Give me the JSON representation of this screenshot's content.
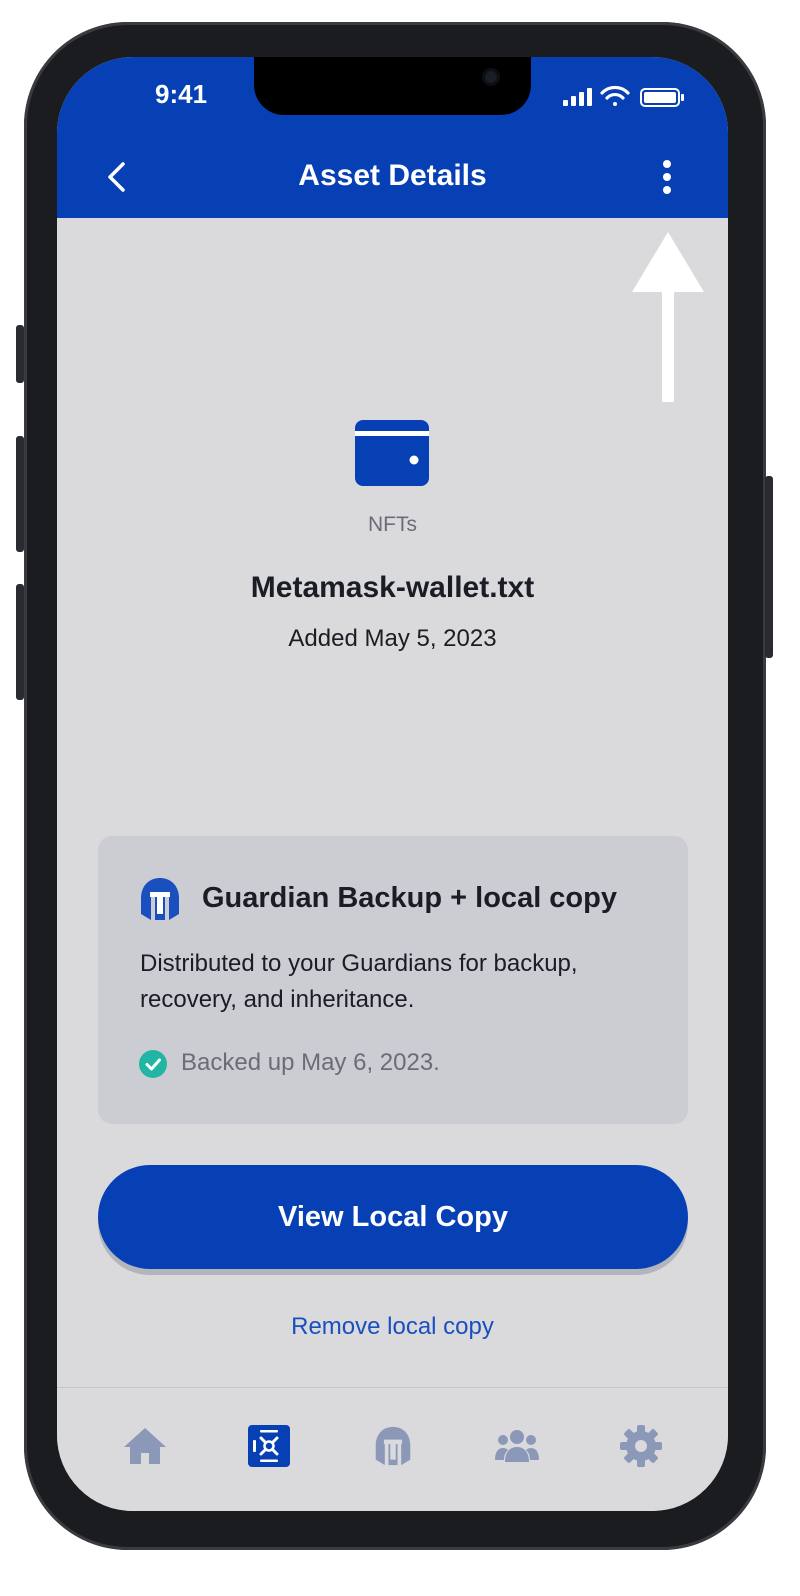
{
  "status_bar": {
    "time": "9:41"
  },
  "header": {
    "title": "Asset Details"
  },
  "asset": {
    "category": "NFTs",
    "name": "Metamask-wallet.txt",
    "added": "Added May 5, 2023"
  },
  "backup_card": {
    "title": "Guardian Backup + local copy",
    "description": "Distributed to your Guardians for backup, recovery, and inheritance.",
    "status": "Backed up May 6, 2023."
  },
  "actions": {
    "primary": "View Local Copy",
    "secondary": "Remove local copy"
  },
  "tabs": [
    {
      "icon": "home-icon",
      "active": false
    },
    {
      "icon": "vault-icon",
      "active": true
    },
    {
      "icon": "guardian-helmet-icon",
      "active": false
    },
    {
      "icon": "people-icon",
      "active": false
    },
    {
      "icon": "gear-icon",
      "active": false
    }
  ],
  "colors": {
    "brand_blue": "#0740b5",
    "background": "#dadadd",
    "card": "#cbcdd2",
    "success": "#21b5a4",
    "tab_inactive": "#8b98b8"
  }
}
